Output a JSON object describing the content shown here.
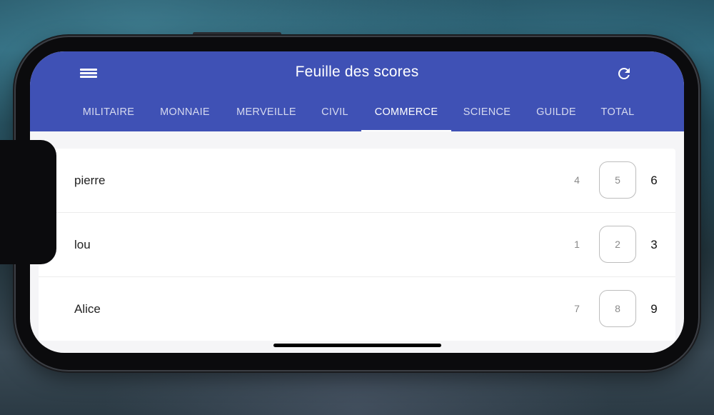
{
  "app": {
    "title": "Feuille des scores"
  },
  "tabs": [
    {
      "label": "MILITAIRE"
    },
    {
      "label": "MONNAIE"
    },
    {
      "label": "MERVEILLE"
    },
    {
      "label": "CIVIL"
    },
    {
      "label": "COMMERCE",
      "active": true
    },
    {
      "label": "SCIENCE"
    },
    {
      "label": "GUILDE"
    },
    {
      "label": "TOTAL"
    }
  ],
  "players": [
    {
      "name": "pierre",
      "prev": "4",
      "value": "5",
      "next": "6"
    },
    {
      "name": "lou",
      "prev": "1",
      "value": "2",
      "next": "3"
    },
    {
      "name": "Alice",
      "prev": "7",
      "value": "8",
      "next": "9"
    }
  ],
  "icons": {
    "menu": "hamburger-menu-icon",
    "refresh": "refresh-icon"
  },
  "colors": {
    "appbar": "#3f51b5",
    "background": "#f5f5f7"
  }
}
